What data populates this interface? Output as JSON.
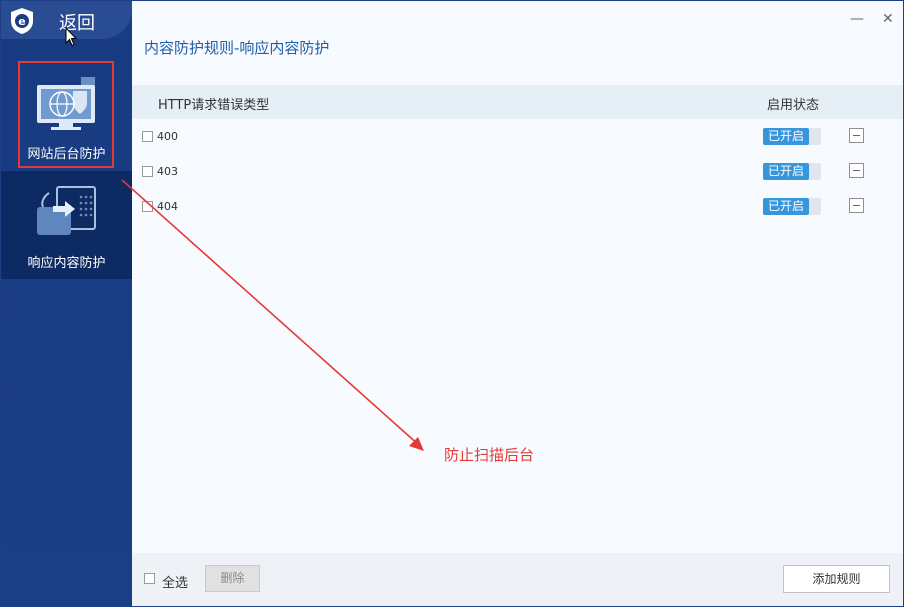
{
  "sidebar": {
    "back_label": "返回",
    "items": [
      {
        "label": "网站后台防护",
        "icon": "monitor-globe-icon",
        "selected": true
      },
      {
        "label": "响应内容防护",
        "icon": "response-shield-icon",
        "selected": false
      }
    ]
  },
  "window": {
    "minimize": "—",
    "close": "✕"
  },
  "main": {
    "title": "内容防护规则-响应内容防护",
    "columns": {
      "type": "HTTP请求错误类型",
      "status": "启用状态"
    },
    "rows": [
      {
        "code": "400",
        "status": "已开启"
      },
      {
        "code": "403",
        "status": "已开启"
      },
      {
        "code": "404",
        "status": "已开启"
      }
    ]
  },
  "annotation": {
    "text": "防止扫描后台"
  },
  "footer": {
    "select_all": "全选",
    "delete": "删除",
    "add_rule": "添加规则"
  },
  "colors": {
    "sidebar": "#1b3f87",
    "accent": "#3796db",
    "annotation": "#e53935"
  }
}
